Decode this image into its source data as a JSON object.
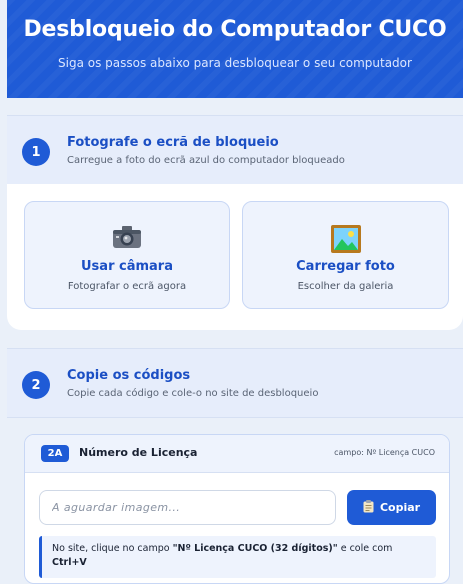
{
  "header": {
    "title": "Desbloqueio do Computador CUCO",
    "subtitle": "Siga os passos abaixo para desbloquear o seu computador"
  },
  "step1": {
    "number": "1",
    "title": "Fotografe o ecrã de bloqueio",
    "subtitle": "Carregue a foto do ecrã azul do computador bloqueado"
  },
  "options": {
    "camera": {
      "icon": "camera-icon",
      "label": "Usar câmara",
      "sub": "Fotografar o ecrã agora"
    },
    "upload": {
      "icon": "picture-icon",
      "label": "Carregar foto",
      "sub": "Escolher da galeria"
    }
  },
  "step2": {
    "number": "2",
    "title": "Copie os códigos",
    "subtitle": "Copie cada código e cole-o no site de desbloqueio"
  },
  "license": {
    "badge": "2A",
    "title": "Número de Licença",
    "field_hint": "campo: Nº Licença CUCO",
    "input_placeholder": "A aguardar imagem...",
    "input_value": "",
    "copy_label": "Copiar",
    "copy_icon": "clipboard-icon",
    "note_prefix": "No site, clique no campo ",
    "note_field": "\"Nº Licença CUCO (32 dígitos)\"",
    "note_middle": " e cole com ",
    "note_shortcut": "Ctrl+V"
  },
  "colors": {
    "primary": "#1f5bd6",
    "primary_text": "#1b4fc4",
    "panel": "#eef3fd"
  }
}
